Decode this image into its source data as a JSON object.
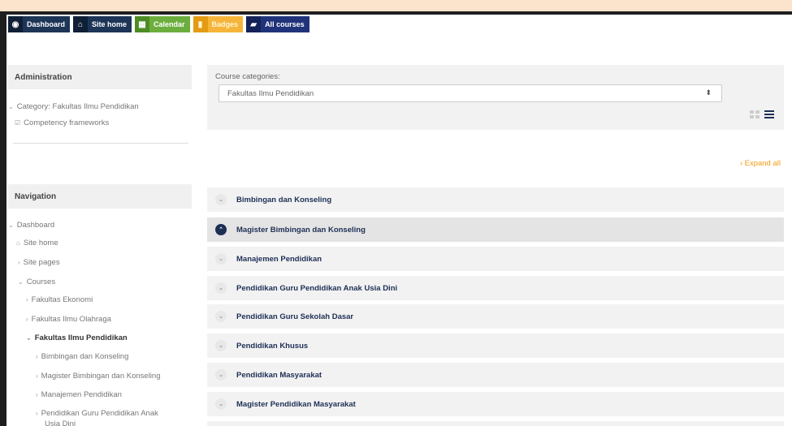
{
  "topbar": {
    "buttons": [
      {
        "label": "Dashboard",
        "icon": "dashboard-icon"
      },
      {
        "label": "Site home",
        "icon": "home-icon"
      },
      {
        "label": "Calendar",
        "icon": "calendar-icon"
      },
      {
        "label": "Badges",
        "icon": "bookmark-icon"
      },
      {
        "label": "All courses",
        "icon": "book-icon"
      }
    ]
  },
  "admin": {
    "title": "Administration",
    "items": [
      "Category: Fakultas Ilmu Pendidikan",
      "Competency frameworks"
    ]
  },
  "navigation": {
    "title": "Navigation",
    "items": [
      "Dashboard",
      "Site home",
      "Site pages",
      "Courses",
      "Fakultas Ekonomi",
      "Fakultas Ilmu Olahraga",
      "Fakultas Ilmu Pendidikan",
      "Bimbingan dan Konseling",
      "Magister Bimbingan dan Konseling",
      "Manajemen Pendidikan",
      "Pendidikan Guru Pendidikan Anak",
      "Usia Dini"
    ]
  },
  "categories": {
    "label": "Course categories:",
    "selected": "Fakultas Ilmu Pendidikan"
  },
  "expand_all": "Expand all",
  "course_rows": [
    "Bimbingan dan Konseling",
    "Magister Bimbingan dan Konseling",
    "Manajemen Pendidikan",
    "Pendidikan Guru Pendidikan Anak Usia Dini",
    "Pendidikan Guru Sekolah Dasar",
    "Pendidikan Khusus",
    "Pendidikan Masyarakat",
    "Magister Pendidikan Masyarakat"
  ],
  "colors": {
    "accent": "#f39c12",
    "navy": "#1d2f55"
  }
}
